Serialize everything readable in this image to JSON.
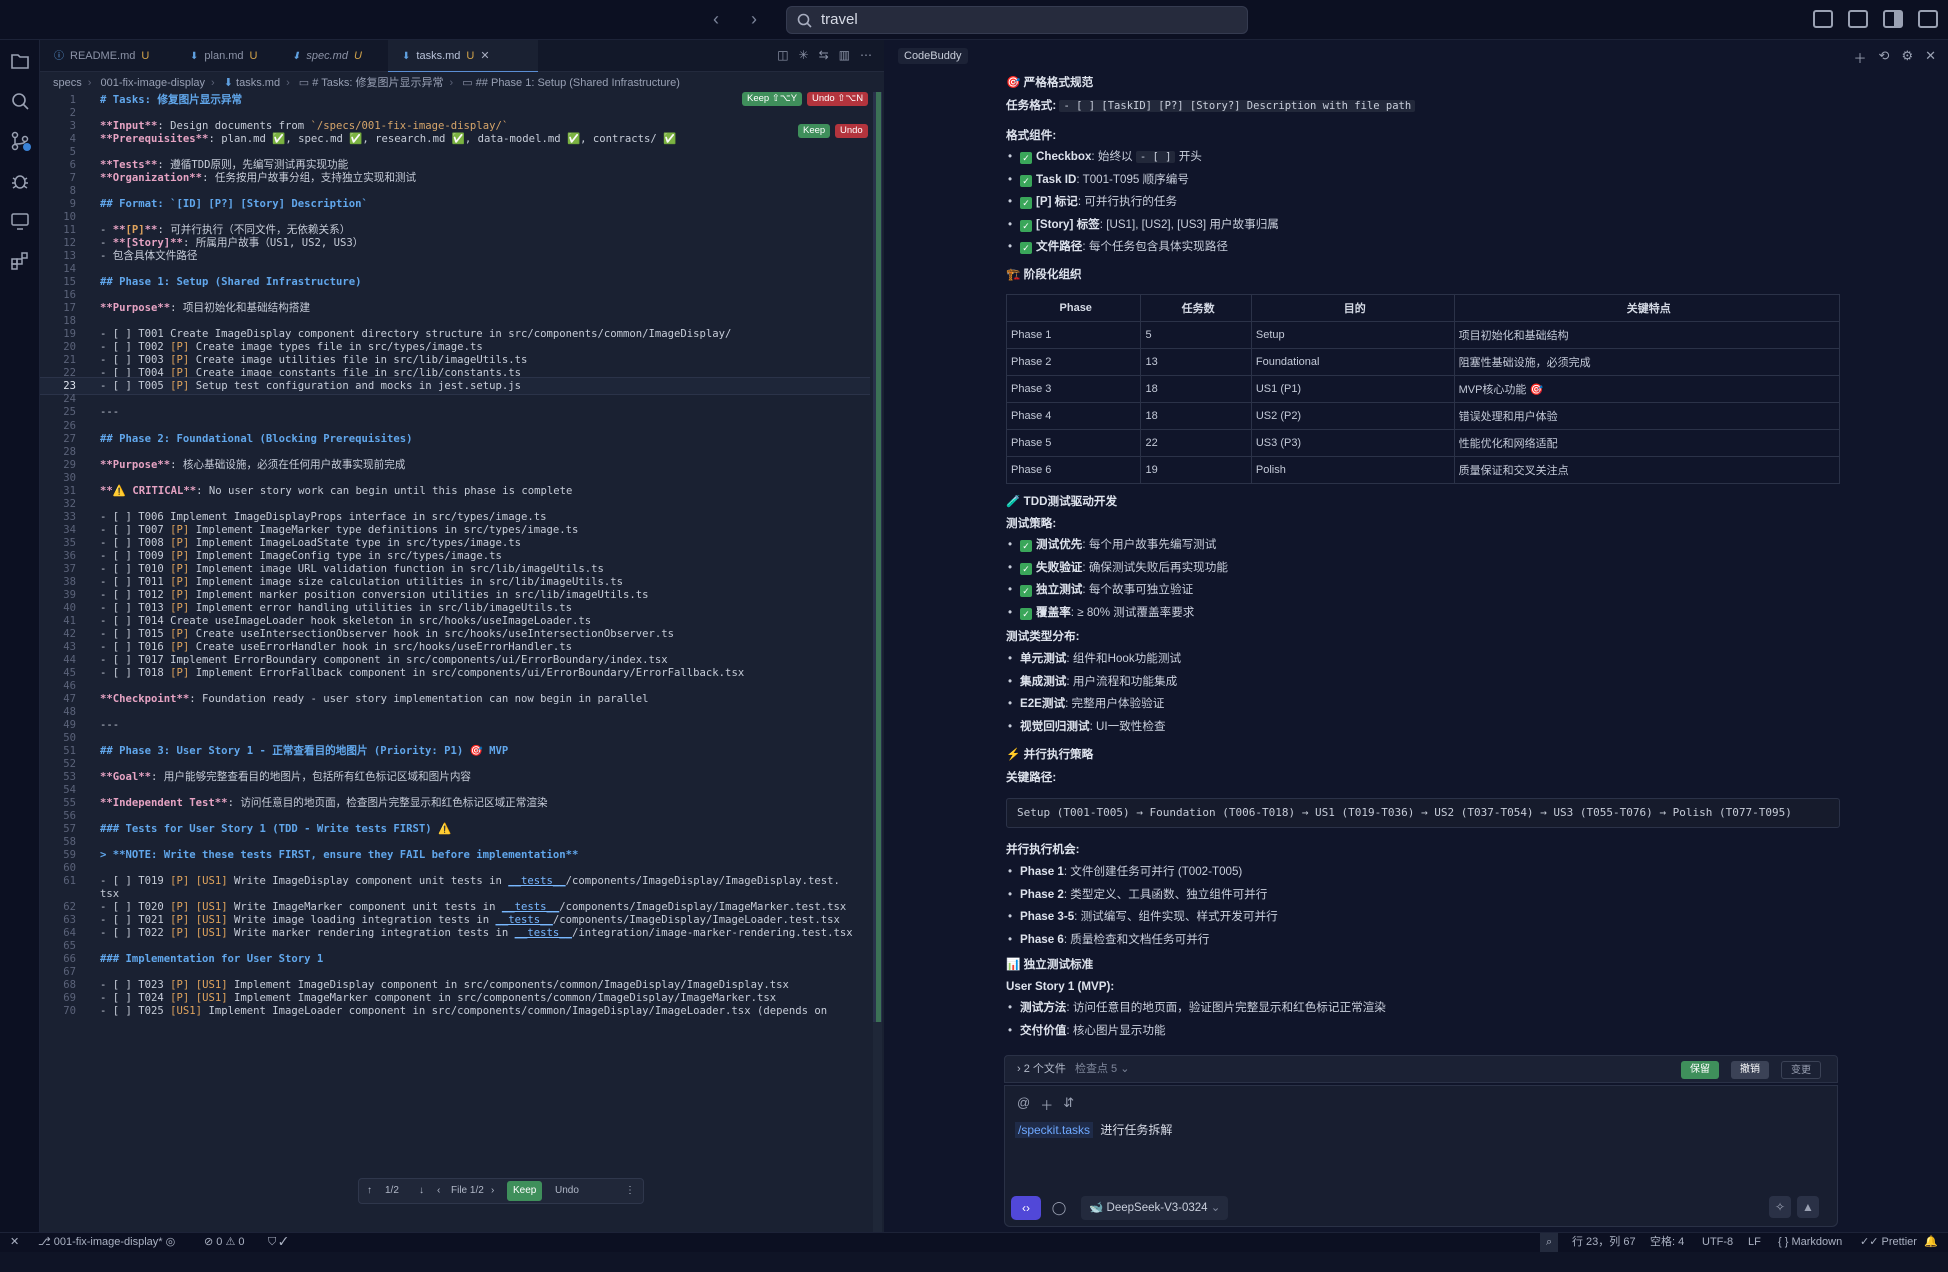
{
  "search": {
    "value": "travel"
  },
  "editor": {
    "tabs": [
      {
        "name": "README.md",
        "flag": "U",
        "icon": "ⓘ"
      },
      {
        "name": "plan.md",
        "flag": "U",
        "icon": "⬇"
      },
      {
        "name": "spec.md",
        "flag": "U",
        "icon": "⬇"
      },
      {
        "name": "tasks.md",
        "flag": "U",
        "icon": "⬇"
      }
    ],
    "breadcrumb": [
      "specs",
      "001-fix-image-display",
      "tasks.md",
      "# Tasks: 修复图片显示异常",
      "## Phase 1: Setup (Shared Infrastructure)"
    ],
    "keep_top": "Keep ⇧⌥Y",
    "undo_top": "Undo ⇧⌥N",
    "keep_small": "Keep",
    "undo_small": "Undo",
    "lines": [
      {
        "n": "1",
        "t": "# Tasks: 修复图片显示异常",
        "c": "hd"
      },
      {
        "n": "2",
        "t": "",
        "c": ""
      },
      {
        "n": "3",
        "t": "**Input**: Design documents from `/specs/001-fix-image-display/`",
        "c": ""
      },
      {
        "n": "4",
        "t": "**Prerequisites**: plan.md ✅, spec.md ✅, research.md ✅, data-model.md ✅, contracts/ ✅",
        "c": ""
      },
      {
        "n": "5",
        "t": "",
        "c": ""
      },
      {
        "n": "6",
        "t": "**Tests**: 遵循TDD原则，先编写测试再实现功能",
        "c": ""
      },
      {
        "n": "7",
        "t": "**Organization**: 任务按用户故事分组，支持独立实现和测试",
        "c": ""
      },
      {
        "n": "8",
        "t": "",
        "c": ""
      },
      {
        "n": "9",
        "t": "## Format: `[ID] [P?] [Story] Description`",
        "c": "hd"
      },
      {
        "n": "10",
        "t": "",
        "c": ""
      },
      {
        "n": "11",
        "t": "- **[P]**: 可并行执行（不同文件，无依赖关系）",
        "c": ""
      },
      {
        "n": "12",
        "t": "- **[Story]**: 所属用户故事（US1, US2, US3）",
        "c": ""
      },
      {
        "n": "13",
        "t": "- 包含具体文件路径",
        "c": ""
      },
      {
        "n": "14",
        "t": "",
        "c": ""
      },
      {
        "n": "15",
        "t": "## Phase 1: Setup (Shared Infrastructure)",
        "c": "hd"
      },
      {
        "n": "16",
        "t": "",
        "c": ""
      },
      {
        "n": "17",
        "t": "**Purpose**: 项目初始化和基础结构搭建",
        "c": ""
      },
      {
        "n": "18",
        "t": "",
        "c": ""
      },
      {
        "n": "19",
        "t": "- [ ] T001 Create ImageDisplay component directory structure in src/components/common/ImageDisplay/",
        "c": ""
      },
      {
        "n": "20",
        "t": "- [ ] T002 [P] Create image types file in src/types/image.ts",
        "c": ""
      },
      {
        "n": "21",
        "t": "- [ ] T003 [P] Create image utilities file in src/lib/imageUtils.ts",
        "c": ""
      },
      {
        "n": "22",
        "t": "- [ ] T004 [P] Create image constants file in src/lib/constants.ts",
        "c": ""
      },
      {
        "n": "23",
        "t": "- [ ] T005 [P] Setup test configuration and mocks in jest.setup.js",
        "c": "cur"
      },
      {
        "n": "24",
        "t": "",
        "c": ""
      },
      {
        "n": "25",
        "t": "---",
        "c": ""
      },
      {
        "n": "26",
        "t": "",
        "c": ""
      },
      {
        "n": "27",
        "t": "## Phase 2: Foundational (Blocking Prerequisites)",
        "c": "hd"
      },
      {
        "n": "28",
        "t": "",
        "c": ""
      },
      {
        "n": "29",
        "t": "**Purpose**: 核心基础设施，必须在任何用户故事实现前完成",
        "c": ""
      },
      {
        "n": "30",
        "t": "",
        "c": ""
      },
      {
        "n": "31",
        "t": "**⚠️ CRITICAL**: No user story work can begin until this phase is complete",
        "c": ""
      },
      {
        "n": "32",
        "t": "",
        "c": ""
      },
      {
        "n": "33",
        "t": "- [ ] T006 Implement ImageDisplayProps interface in src/types/image.ts",
        "c": ""
      },
      {
        "n": "34",
        "t": "- [ ] T007 [P] Implement ImageMarker type definitions in src/types/image.ts",
        "c": ""
      },
      {
        "n": "35",
        "t": "- [ ] T008 [P] Implement ImageLoadState type in src/types/image.ts",
        "c": ""
      },
      {
        "n": "36",
        "t": "- [ ] T009 [P] Implement ImageConfig type in src/types/image.ts",
        "c": ""
      },
      {
        "n": "37",
        "t": "- [ ] T010 [P] Implement image URL validation function in src/lib/imageUtils.ts",
        "c": ""
      },
      {
        "n": "38",
        "t": "- [ ] T011 [P] Implement image size calculation utilities in src/lib/imageUtils.ts",
        "c": ""
      },
      {
        "n": "39",
        "t": "- [ ] T012 [P] Implement marker position conversion utilities in src/lib/imageUtils.ts",
        "c": ""
      },
      {
        "n": "40",
        "t": "- [ ] T013 [P] Implement error handling utilities in src/lib/imageUtils.ts",
        "c": ""
      },
      {
        "n": "41",
        "t": "- [ ] T014 Create useImageLoader hook skeleton in src/hooks/useImageLoader.ts",
        "c": ""
      },
      {
        "n": "42",
        "t": "- [ ] T015 [P] Create useIntersectionObserver hook in src/hooks/useIntersectionObserver.ts",
        "c": ""
      },
      {
        "n": "43",
        "t": "- [ ] T016 [P] Create useErrorHandler hook in src/hooks/useErrorHandler.ts",
        "c": ""
      },
      {
        "n": "44",
        "t": "- [ ] T017 Implement ErrorBoundary component in src/components/ui/ErrorBoundary/index.tsx",
        "c": ""
      },
      {
        "n": "45",
        "t": "- [ ] T018 [P] Implement ErrorFallback component in src/components/ui/ErrorBoundary/ErrorFallback.tsx",
        "c": ""
      },
      {
        "n": "46",
        "t": "",
        "c": ""
      },
      {
        "n": "47",
        "t": "**Checkpoint**: Foundation ready - user story implementation can now begin in parallel",
        "c": ""
      },
      {
        "n": "48",
        "t": "",
        "c": ""
      },
      {
        "n": "49",
        "t": "---",
        "c": ""
      },
      {
        "n": "50",
        "t": "",
        "c": ""
      },
      {
        "n": "51",
        "t": "## Phase 3: User Story 1 - 正常查看目的地图片 (Priority: P1) 🎯 MVP",
        "c": "hd"
      },
      {
        "n": "52",
        "t": "",
        "c": ""
      },
      {
        "n": "53",
        "t": "**Goal**: 用户能够完整查看目的地图片，包括所有红色标记区域和图片内容",
        "c": ""
      },
      {
        "n": "54",
        "t": "",
        "c": ""
      },
      {
        "n": "55",
        "t": "**Independent Test**: 访问任意目的地页面，检查图片完整显示和红色标记区域正常渲染",
        "c": ""
      },
      {
        "n": "56",
        "t": "",
        "c": ""
      },
      {
        "n": "57",
        "t": "### Tests for User Story 1 (TDD - Write tests FIRST) ⚠️",
        "c": "hd"
      },
      {
        "n": "58",
        "t": "",
        "c": ""
      },
      {
        "n": "59",
        "t": "> **NOTE: Write these tests FIRST, ensure they FAIL before implementation**",
        "c": "hd"
      },
      {
        "n": "60",
        "t": "",
        "c": ""
      },
      {
        "n": "61",
        "t": "- [ ] T019 [P] [US1] Write ImageDisplay component unit tests in __tests__/components/ImageDisplay/ImageDisplay.test.",
        "c": ""
      },
      {
        "n": "",
        "t": "tsx",
        "c": ""
      },
      {
        "n": "62",
        "t": "- [ ] T020 [P] [US1] Write ImageMarker component unit tests in __tests__/components/ImageDisplay/ImageMarker.test.tsx",
        "c": ""
      },
      {
        "n": "63",
        "t": "- [ ] T021 [P] [US1] Write image loading integration tests in __tests__/components/ImageDisplay/ImageLoader.test.tsx",
        "c": ""
      },
      {
        "n": "64",
        "t": "- [ ] T022 [P] [US1] Write marker rendering integration tests in __tests__/integration/image-marker-rendering.test.tsx",
        "c": ""
      },
      {
        "n": "65",
        "t": "",
        "c": ""
      },
      {
        "n": "66",
        "t": "### Implementation for User Story 1",
        "c": "hd"
      },
      {
        "n": "67",
        "t": "",
        "c": ""
      },
      {
        "n": "68",
        "t": "- [ ] T023 [P] [US1] Implement ImageDisplay component in src/components/common/ImageDisplay/ImageDisplay.tsx",
        "c": ""
      },
      {
        "n": "69",
        "t": "- [ ] T024 [P] [US1] Implement ImageMarker component in src/components/common/ImageDisplay/ImageMarker.tsx",
        "c": ""
      },
      {
        "n": "70",
        "t": "- [ ] T025 [US1] Implement ImageLoader component in src/components/common/ImageDisplay/ImageLoader.tsx (depends on",
        "c": ""
      }
    ],
    "float": {
      "count": "1/2",
      "file": "File 1/2",
      "keep": "Keep",
      "undo": "Undo"
    }
  },
  "panel": {
    "title": "CodeBuddy",
    "sec_format": "🎯 严格格式规范",
    "task_format_label": "任务格式:",
    "task_format_code": "- [ ] [TaskID] [P?] [Story?] Description with file path",
    "components_label": "格式组件:",
    "components": [
      {
        "b": "Checkbox",
        "pre": "",
        "t": ": 始终以 ",
        "code": "- [ ]",
        "post": " 开头"
      },
      {
        "b": "Task ID",
        "t": ": T001-T095 顺序编号"
      },
      {
        "b": "[P] 标记",
        "t": ": 可并行执行的任务"
      },
      {
        "b": "[Story] 标签",
        "t": ": [US1], [US2], [US3] 用户故事归属"
      },
      {
        "b": "文件路径",
        "t": ": 每个任务包含具体实现路径"
      }
    ],
    "sec_phase": "🏗️ 阶段化组织",
    "table": {
      "headers": [
        "Phase",
        "任务数",
        "目的",
        "关键特点"
      ],
      "rows": [
        [
          "Phase 1",
          "5",
          "Setup",
          "项目初始化和基础结构"
        ],
        [
          "Phase 2",
          "13",
          "Foundational",
          "阻塞性基础设施，必须完成"
        ],
        [
          "Phase 3",
          "18",
          "US1 (P1)",
          "MVP核心功能 🎯"
        ],
        [
          "Phase 4",
          "18",
          "US2 (P2)",
          "错误处理和用户体验"
        ],
        [
          "Phase 5",
          "22",
          "US3 (P3)",
          "性能优化和网络适配"
        ],
        [
          "Phase 6",
          "19",
          "Polish",
          "质量保证和交叉关注点"
        ]
      ]
    },
    "sec_tdd": "🧪 TDD测试驱动开发",
    "strategy_label": "测试策略:",
    "strategy": [
      {
        "b": "测试优先",
        "t": ": 每个用户故事先编写测试"
      },
      {
        "b": "失败验证",
        "t": ": 确保测试失败后再实现功能"
      },
      {
        "b": "独立测试",
        "t": ": 每个故事可独立验证"
      },
      {
        "b": "覆盖率",
        "t": ": ≥ 80% 测试覆盖率要求"
      }
    ],
    "types_label": "测试类型分布:",
    "types": [
      {
        "b": "单元测试",
        "t": ": 组件和Hook功能测试"
      },
      {
        "b": "集成测试",
        "t": ": 用户流程和功能集成"
      },
      {
        "b": "E2E测试",
        "t": ": 完整用户体验验证"
      },
      {
        "b": "视觉回归测试",
        "t": ": UI一致性检查"
      }
    ],
    "sec_parallel": "⚡ 并行执行策略",
    "critical_label": "关键路径:",
    "critical_path": "Setup (T001-T005) → Foundation (T006-T018) → US1 (T019-T036) → US2 (T037-T054) → US3 (T055-T076) → Polish (T077-T095)",
    "opp_label": "并行执行机会:",
    "opps": [
      {
        "b": "Phase 1",
        "t": ": 文件创建任务可并行 (T002-T005)"
      },
      {
        "b": "Phase 2",
        "t": ": 类型定义、工具函数、独立组件可并行"
      },
      {
        "b": "Phase 3-5",
        "t": ": 测试编写、组件实现、样式开发可并行"
      },
      {
        "b": "Phase 6",
        "t": ": 质量检查和文档任务可并行"
      }
    ],
    "sec_indep": "📊 独立测试标准",
    "us1_label": "User Story 1 (MVP):",
    "us1": [
      {
        "b": "测试方法",
        "t": ": 访问任意目的地页面，验证图片完整显示和红色标记正常渲染"
      },
      {
        "b": "交付价值",
        "t": ": 核心图片显示功能"
      }
    ]
  },
  "chat": {
    "files": "2 个文件",
    "checkpoint": "检查点 5",
    "keep": "保留",
    "revert": "撤销",
    "changes": "变更",
    "command": "/speckit.tasks",
    "message": "进行任务拆解",
    "model": "DeepSeek-V3-0324"
  },
  "status": {
    "branch": "001-fix-image-display*",
    "problems": "⊘ 0 ⚠ 0",
    "position": "行 23，列 67",
    "spaces": "空格: 4",
    "encoding": "UTF-8",
    "eol": "LF",
    "language": "Markdown",
    "formatter": "Prettier"
  }
}
